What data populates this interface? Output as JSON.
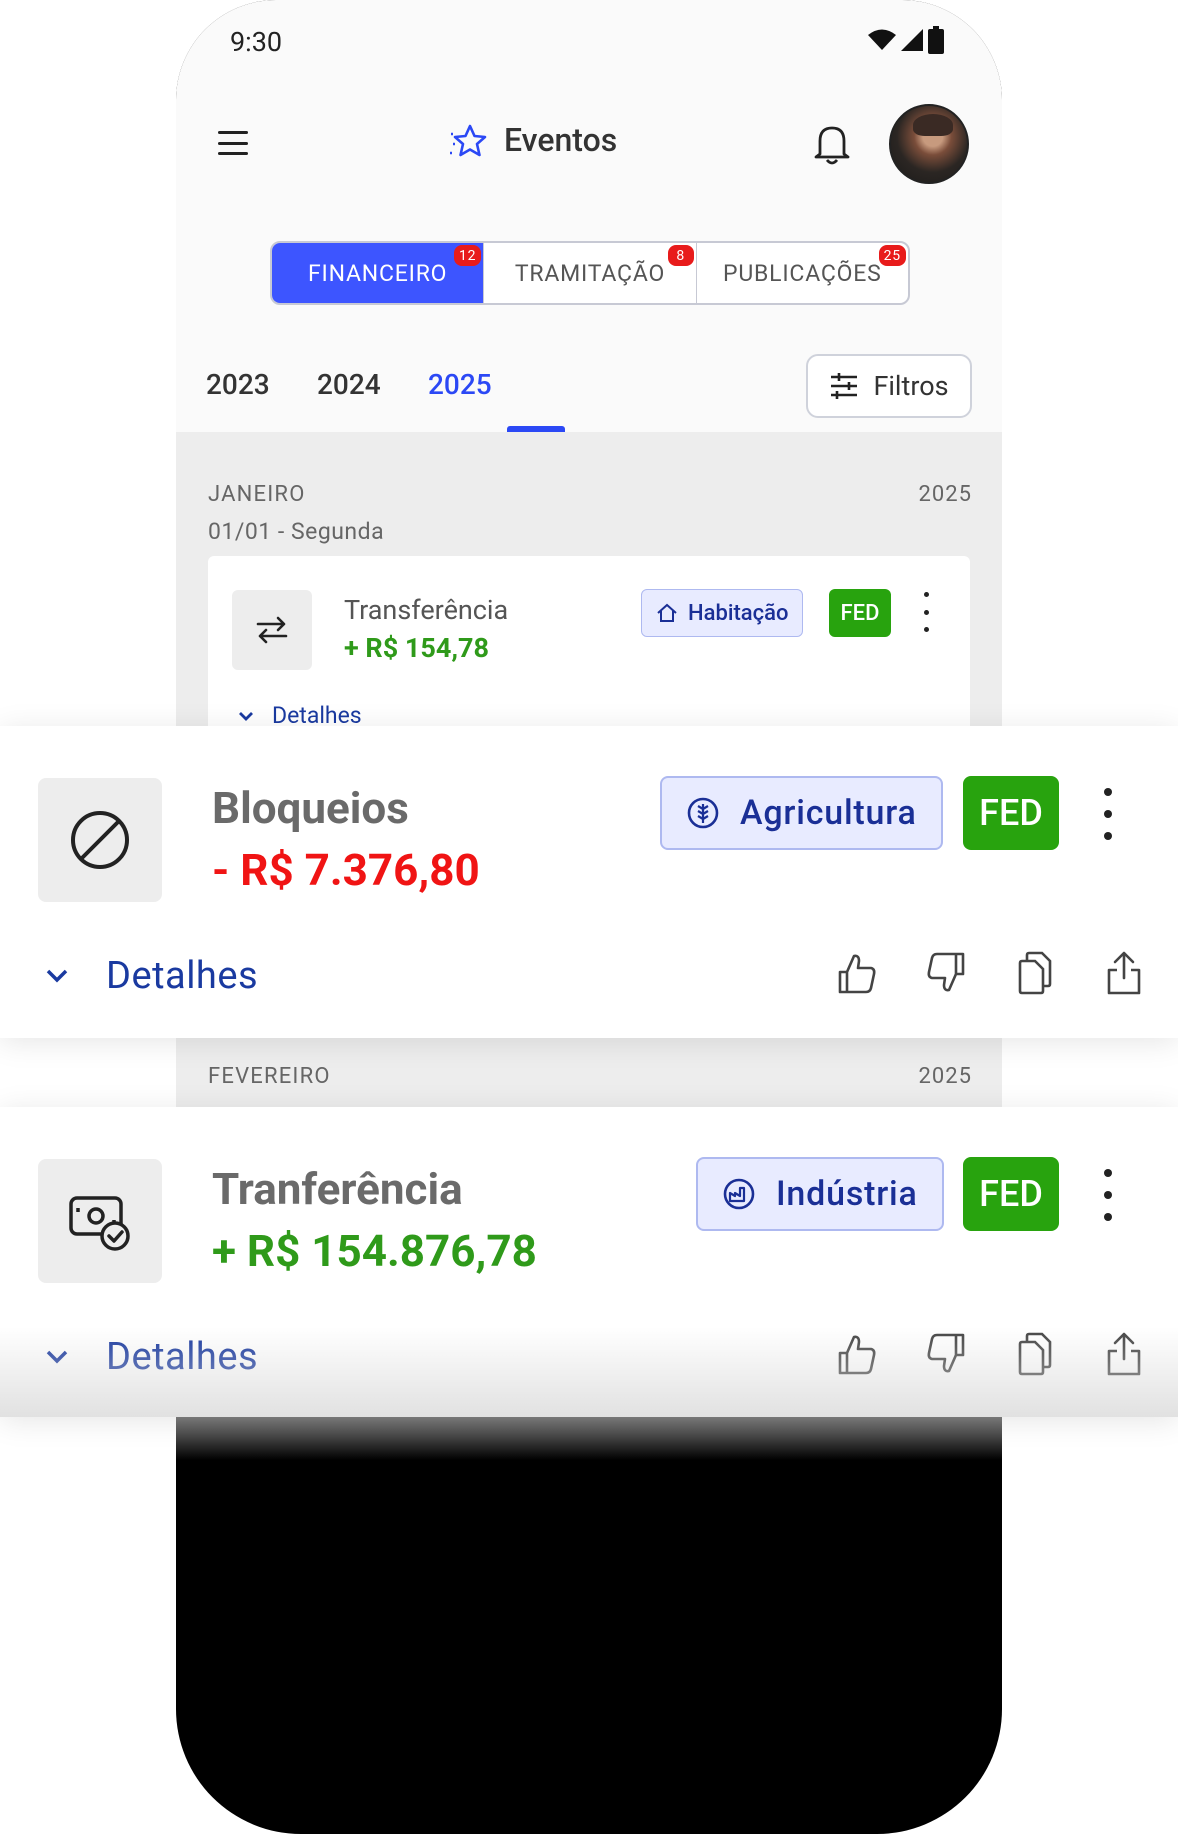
{
  "status_bar": {
    "time": "9:30"
  },
  "app_bar": {
    "title": "Eventos"
  },
  "segments": [
    {
      "label": "FINANCEIRO",
      "badge": "12",
      "active": true
    },
    {
      "label": "TRAMITAÇÃO",
      "badge": "8",
      "active": false
    },
    {
      "label": "PUBLICAÇÕES",
      "badge": "25",
      "active": false
    }
  ],
  "years": [
    {
      "label": "2023",
      "active": false
    },
    {
      "label": "2024",
      "active": false
    },
    {
      "label": "2025",
      "active": true
    }
  ],
  "filter_label": "Filtros",
  "months": [
    {
      "name": "JANEIRO",
      "year": "2025",
      "date_label": "01/01 - Segunda"
    },
    {
      "name": "FEVEREIRO",
      "year": "2025"
    }
  ],
  "events": [
    {
      "title": "Transferência",
      "amount": "+ R$ 154,78",
      "icon": "transfer-icon",
      "category": "Habitação",
      "category_icon": "house-icon",
      "tag": "FED",
      "details_label": "Detalhes"
    },
    {
      "title": "Bloqueios",
      "amount": "- R$ 7.376,80",
      "icon": "block-icon",
      "category": "Agricultura",
      "category_icon": "wheat-icon",
      "tag": "FED",
      "details_label": "Detalhes"
    },
    {
      "title": "Tranferência",
      "amount": "+ R$ 154.876,78",
      "icon": "money-check-icon",
      "category": "Indústria",
      "category_icon": "factory-icon",
      "tag": "FED",
      "details_label": "Detalhes"
    }
  ],
  "colors": {
    "primary": "#2b48f5",
    "negative": "#f01414",
    "positive": "#2f9a1a",
    "fed": "#28a30e",
    "chip_bg": "#e8ebff"
  }
}
